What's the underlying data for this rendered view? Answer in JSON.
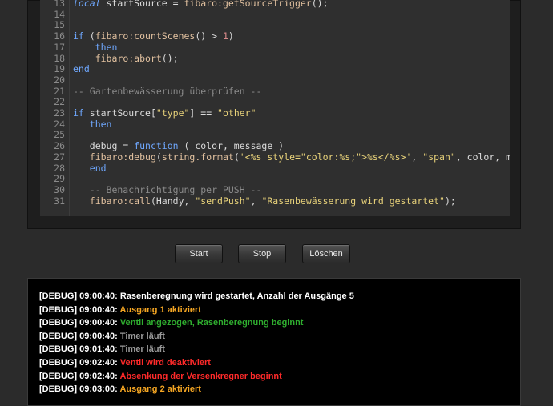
{
  "editor": {
    "lines": [
      {
        "n": "13",
        "tokens": [
          {
            "t": "local ",
            "c": "it"
          },
          {
            "t": "startSource = ",
            "c": ""
          },
          {
            "t": "fibaro:getSourceTrigger",
            "c": "fn"
          },
          {
            "t": "();",
            "c": ""
          }
        ]
      },
      {
        "n": "14",
        "tokens": []
      },
      {
        "n": "15",
        "tokens": []
      },
      {
        "n": "16",
        "tokens": [
          {
            "t": "if ",
            "c": "kw"
          },
          {
            "t": "(",
            "c": ""
          },
          {
            "t": "fibaro:countScenes",
            "c": "fn"
          },
          {
            "t": "() > ",
            "c": ""
          },
          {
            "t": "1",
            "c": "num"
          },
          {
            "t": ")",
            "c": ""
          }
        ]
      },
      {
        "n": "17",
        "tokens": [
          {
            "t": "    then",
            "c": "kw"
          }
        ]
      },
      {
        "n": "18",
        "tokens": [
          {
            "t": "    ",
            "c": ""
          },
          {
            "t": "fibaro:abort",
            "c": "fn"
          },
          {
            "t": "();",
            "c": ""
          }
        ]
      },
      {
        "n": "19",
        "tokens": [
          {
            "t": "end",
            "c": "kw"
          }
        ]
      },
      {
        "n": "20",
        "tokens": []
      },
      {
        "n": "21",
        "tokens": [
          {
            "t": "-- Gartenbewässerung überprüfen --",
            "c": "cm"
          }
        ]
      },
      {
        "n": "22",
        "tokens": []
      },
      {
        "n": "23",
        "tokens": [
          {
            "t": "if ",
            "c": "kw"
          },
          {
            "t": "startSource[",
            "c": ""
          },
          {
            "t": "\"type\"",
            "c": "str"
          },
          {
            "t": "] == ",
            "c": ""
          },
          {
            "t": "\"other\"",
            "c": "str"
          }
        ]
      },
      {
        "n": "24",
        "tokens": [
          {
            "t": "   then",
            "c": "kw"
          }
        ]
      },
      {
        "n": "25",
        "tokens": []
      },
      {
        "n": "26",
        "tokens": [
          {
            "t": "   debug = ",
            "c": ""
          },
          {
            "t": "function",
            "c": "kw"
          },
          {
            "t": " ( color, message )",
            "c": ""
          }
        ]
      },
      {
        "n": "27",
        "tokens": [
          {
            "t": "   ",
            "c": ""
          },
          {
            "t": "fibaro:debug",
            "c": "fn"
          },
          {
            "t": "(",
            "c": ""
          },
          {
            "t": "string.format",
            "c": "fn"
          },
          {
            "t": "(",
            "c": ""
          },
          {
            "t": "'<%s style=\"color:%s;\">%s</%s>'",
            "c": "str"
          },
          {
            "t": ", ",
            "c": ""
          },
          {
            "t": "\"span\"",
            "c": "str"
          },
          {
            "t": ", color, messa",
            "c": ""
          }
        ]
      },
      {
        "n": "28",
        "tokens": [
          {
            "t": "   end",
            "c": "kw"
          }
        ]
      },
      {
        "n": "29",
        "tokens": []
      },
      {
        "n": "30",
        "tokens": [
          {
            "t": "   -- Benachrichtigung per PUSH --",
            "c": "cm"
          }
        ]
      },
      {
        "n": "31",
        "tokens": [
          {
            "t": "   ",
            "c": ""
          },
          {
            "t": "fibaro:call",
            "c": "fn"
          },
          {
            "t": "(Handy, ",
            "c": ""
          },
          {
            "t": "\"sendPush\"",
            "c": "str"
          },
          {
            "t": ", ",
            "c": ""
          },
          {
            "t": "\"Rasenbewässerung wird gestartet\"",
            "c": "str"
          },
          {
            "t": ");",
            "c": ""
          }
        ]
      }
    ]
  },
  "toolbar": {
    "start_label": "Start",
    "stop_label": "Stop",
    "clear_label": "Löschen"
  },
  "log": {
    "entries": [
      {
        "prefix": "[DEBUG] 09:00:40:",
        "message": "Rasenberegnung wird gestartet, Anzahl der Ausgänge 5",
        "color": "#ffffff"
      },
      {
        "prefix": "[DEBUG] 09:00:40:",
        "message": "Ausgang 1 aktiviert",
        "color": "#f5a623"
      },
      {
        "prefix": "[DEBUG] 09:00:40:",
        "message": "Ventil angezogen, Rasenberegnung beginnt",
        "color": "#2fae2f"
      },
      {
        "prefix": "[DEBUG] 09:00:40:",
        "message": "Timer läuft",
        "color": "#9a9a9a"
      },
      {
        "prefix": "[DEBUG] 09:01:40:",
        "message": "Timer läuft",
        "color": "#9a9a9a"
      },
      {
        "prefix": "[DEBUG] 09:02:40:",
        "message": "Ventil wird deaktiviert",
        "color": "#ff2a2a"
      },
      {
        "prefix": "[DEBUG] 09:02:40:",
        "message": "Absenkung der Versenkregner beginnt",
        "color": "#ff2a2a"
      },
      {
        "prefix": "[DEBUG] 09:03:00:",
        "message": "Ausgang 2 aktiviert",
        "color": "#f5a623"
      }
    ]
  }
}
